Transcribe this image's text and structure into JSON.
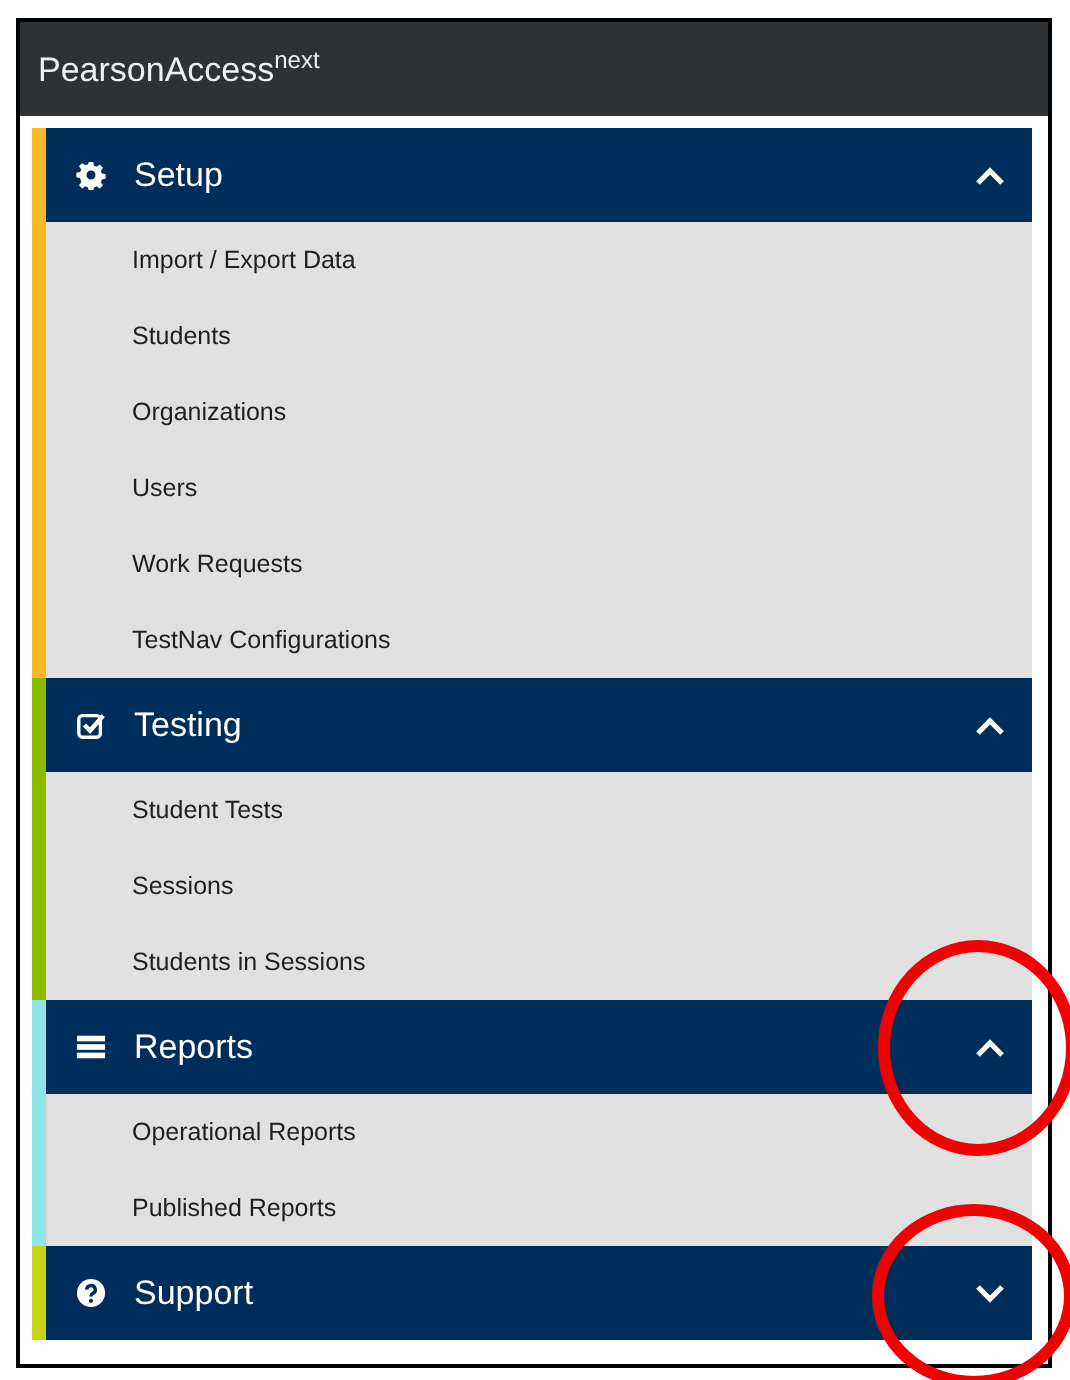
{
  "app_title": "PearsonAccess$^{next}$",
  "sections": [
    {
      "title": "Setup",
      "kind": "gear",
      "color": "#fbb829",
      "expanded": true,
      "items": [
        "Import / Export Data",
        "Students",
        "Organizations",
        "Users",
        "Work Requests",
        "TestNav Configurations"
      ]
    },
    {
      "title": "Testing",
      "kind": "check",
      "color": "#8abb00",
      "expanded": true,
      "items": [
        "Student Tests",
        "Sessions",
        "Students in Sessions"
      ]
    },
    {
      "title": "Reports",
      "kind": "list",
      "color": "#8fe3ea",
      "expanded": true,
      "items": [
        "Operational Reports",
        "Published Reports"
      ]
    },
    {
      "title": "Support",
      "kind": "help",
      "color": "#c8d41a",
      "expanded": false
    }
  ]
}
